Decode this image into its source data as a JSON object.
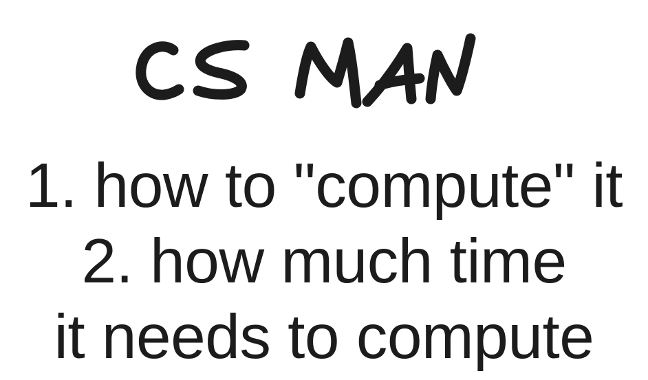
{
  "title": {
    "text": "CS MAN"
  },
  "points": [
    "1. how to \"compute\" it",
    "2. how much time",
    "it needs to compute"
  ],
  "colors": {
    "ink": "#1c1c1c",
    "background": "#ffffff"
  }
}
